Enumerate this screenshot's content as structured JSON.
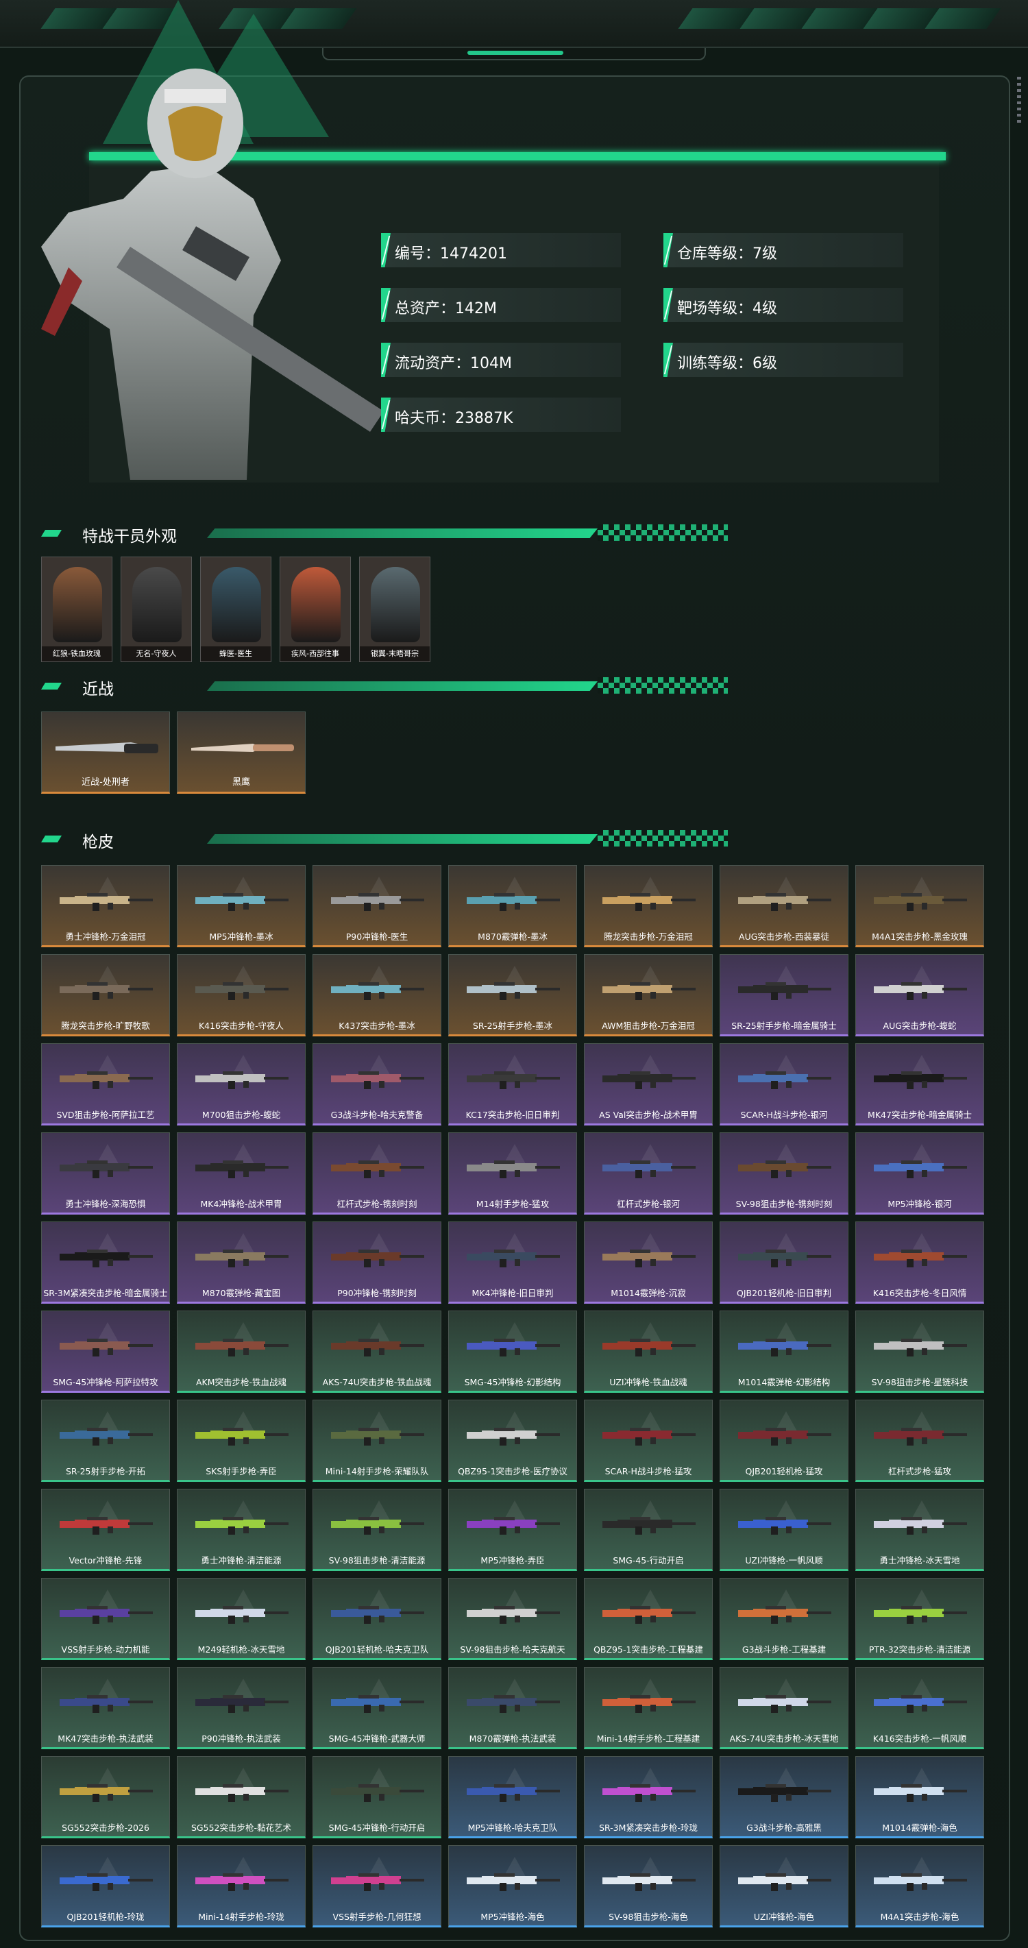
{
  "stats": [
    {
      "label": "编号：1474201"
    },
    {
      "label": "仓库等级：7级"
    },
    {
      "label": "总资产：142M"
    },
    {
      "label": "靶场等级：4级"
    },
    {
      "label": "流动资产：104M"
    },
    {
      "label": "训练等级：6级"
    },
    {
      "label": "哈夫币：23887K"
    }
  ],
  "sections": {
    "operators": "特战干员外观",
    "melee": "近战",
    "skins": "枪皮"
  },
  "operators": [
    {
      "name": "红狼-铁血玫瑰",
      "color": "#8a5a3a"
    },
    {
      "name": "无名-守夜人",
      "color": "#4a4a4a"
    },
    {
      "name": "蜂医-医生",
      "color": "#3a5a6a"
    },
    {
      "name": "疾风-西部往事",
      "color": "#c05a3a"
    },
    {
      "name": "银翼-末晤哥宗",
      "color": "#5a6a70"
    }
  ],
  "melee": [
    {
      "name": "近战-处刑者"
    },
    {
      "name": "黑鹰"
    }
  ],
  "skins": [
    {
      "name": "勇士冲锋枪-万金泪冠",
      "rarity": "orange",
      "gun": "#c9b48a"
    },
    {
      "name": "MP5冲锋枪-墨冰",
      "rarity": "orange",
      "gun": "#6fb0c0"
    },
    {
      "name": "P90冲锋枪-医生",
      "rarity": "orange",
      "gun": "#9a9a9a"
    },
    {
      "name": "M870霰弹枪-墨冰",
      "rarity": "orange",
      "gun": "#5aa0b0"
    },
    {
      "name": "腾龙突击步枪-万金泪冠",
      "rarity": "orange",
      "gun": "#c9a060"
    },
    {
      "name": "AUG突击步枪-西装暴徒",
      "rarity": "orange",
      "gun": "#b0a080"
    },
    {
      "name": "M4A1突击步枪-黑金玫瑰",
      "rarity": "orange",
      "gun": "#6a5a3a"
    },
    {
      "name": "腾龙突击步枪-旷野牧歌",
      "rarity": "orange",
      "gun": "#7a6a5a"
    },
    {
      "name": "K416突击步枪-守夜人",
      "rarity": "orange",
      "gun": "#5a5a50"
    },
    {
      "name": "K437突击步枪-墨冰",
      "rarity": "orange",
      "gun": "#70b0c0"
    },
    {
      "name": "SR-25射手步枪-墨冰",
      "rarity": "orange",
      "gun": "#b0c0c8"
    },
    {
      "name": "AWM狙击步枪-万金泪冠",
      "rarity": "orange",
      "gun": "#c0a070"
    },
    {
      "name": "SR-25射手步枪-暗金属骑士",
      "rarity": "purple",
      "gun": "#2a2a2a"
    },
    {
      "name": "AUG突击步枪-蝮蛇",
      "rarity": "purple",
      "gun": "#d0d0d0"
    },
    {
      "name": "SVD狙击步枪-阿萨拉工艺",
      "rarity": "purple",
      "gun": "#8a6a50"
    },
    {
      "name": "M700狙击步枪-蝮蛇",
      "rarity": "purple",
      "gun": "#c0c0c0"
    },
    {
      "name": "G3战斗步枪-哈夫克警备",
      "rarity": "purple",
      "gun": "#a05a6a"
    },
    {
      "name": "KC17突击步枪-旧日审判",
      "rarity": "purple",
      "gun": "#3a3a3a"
    },
    {
      "name": "AS Val突击步枪-战术甲胄",
      "rarity": "purple",
      "gun": "#2a2a2a"
    },
    {
      "name": "SCAR-H战斗步枪-银河",
      "rarity": "purple",
      "gun": "#4a70b0"
    },
    {
      "name": "MK47突击步枪-暗金属骑士",
      "rarity": "purple",
      "gun": "#1a1a1a"
    },
    {
      "name": "勇士冲锋枪-深海恐惧",
      "rarity": "purple",
      "gun": "#3a3a40"
    },
    {
      "name": "MK4冲锋枪-战术甲胄",
      "rarity": "purple",
      "gun": "#2a2a2a"
    },
    {
      "name": "杠杆式步枪-镌刻时刻",
      "rarity": "purple",
      "gun": "#7a4a30"
    },
    {
      "name": "M14射手步枪-猛攻",
      "rarity": "purple",
      "gun": "#8a8a8a"
    },
    {
      "name": "杠杆式步枪-银河",
      "rarity": "purple",
      "gun": "#4a60a0"
    },
    {
      "name": "SV-98狙击步枪-镌刻时刻",
      "rarity": "purple",
      "gun": "#6a4a30"
    },
    {
      "name": "MP5冲锋枪-银河",
      "rarity": "purple",
      "gun": "#4a70c0"
    },
    {
      "name": "SR-3M紧凑突击步枪-暗金属骑士",
      "rarity": "purple",
      "gun": "#1a1a1a"
    },
    {
      "name": "M870霰弹枪-藏宝图",
      "rarity": "purple",
      "gun": "#8a7a60"
    },
    {
      "name": "P90冲锋枪-镌刻时刻",
      "rarity": "purple",
      "gun": "#6a3a2a"
    },
    {
      "name": "MK4冲锋枪-旧日审判",
      "rarity": "purple",
      "gun": "#3a4a60"
    },
    {
      "name": "M1014霰弹枪-沉寂",
      "rarity": "purple",
      "gun": "#9a7a5a"
    },
    {
      "name": "QJB201轻机枪-旧日审判",
      "rarity": "purple",
      "gun": "#3a4a50"
    },
    {
      "name": "K416突击步枪-冬日风情",
      "rarity": "purple",
      "gun": "#a04a30"
    },
    {
      "name": "SMG-45冲锋枪-阿萨拉特攻",
      "rarity": "purple",
      "gun": "#8a5a50"
    },
    {
      "name": "AKM突击步枪-铁血战魂",
      "rarity": "green",
      "gun": "#8a4a3a"
    },
    {
      "name": "AKS-74U突击步枪-铁血战魂",
      "rarity": "green",
      "gun": "#6a3a2a"
    },
    {
      "name": "SMG-45冲锋枪-幻影结构",
      "rarity": "green",
      "gun": "#4a5ac0"
    },
    {
      "name": "UZI冲锋枪-铁血战魂",
      "rarity": "green",
      "gun": "#9a3a2a"
    },
    {
      "name": "M1014霰弹枪-幻影结构",
      "rarity": "green",
      "gun": "#4a6ac0"
    },
    {
      "name": "SV-98狙击步枪-星链科技",
      "rarity": "green",
      "gun": "#c0c0c0"
    },
    {
      "name": "SR-25射手步枪-开拓",
      "rarity": "green",
      "gun": "#3a6a9a"
    },
    {
      "name": "SKS射手步枪-弄臣",
      "rarity": "green",
      "gun": "#a0c030"
    },
    {
      "name": "Mini-14射手步枪-荣耀队队",
      "rarity": "green",
      "gun": "#5a6a40"
    },
    {
      "name": "QBZ95-1突击步枪-医疗协议",
      "rarity": "green",
      "gun": "#d0d0d0"
    },
    {
      "name": "SCAR-H战斗步枪-猛攻",
      "rarity": "green",
      "gun": "#8a2a30"
    },
    {
      "name": "QJB201轻机枪-猛攻",
      "rarity": "green",
      "gun": "#7a2a30"
    },
    {
      "name": "杠杆式步枪-猛攻",
      "rarity": "green",
      "gun": "#7a2a30"
    },
    {
      "name": "Vector冲锋枪-先锋",
      "rarity": "green",
      "gun": "#c03a3a"
    },
    {
      "name": "勇士冲锋枪-清洁能源",
      "rarity": "green",
      "gun": "#9ad040"
    },
    {
      "name": "SV-98狙击步枪-清洁能源",
      "rarity": "green",
      "gun": "#8ac040"
    },
    {
      "name": "MP5冲锋枪-弄臣",
      "rarity": "green",
      "gun": "#8a40c0"
    },
    {
      "name": "SMG-45-行动开启",
      "rarity": "green",
      "gun": "#2a2a2a"
    },
    {
      "name": "UZI冲锋枪-一帆风顺",
      "rarity": "green",
      "gun": "#3a60d0"
    },
    {
      "name": "勇士冲锋枪-冰天雪地",
      "rarity": "green",
      "gun": "#d0d0e0"
    },
    {
      "name": "VSS射手步枪-动力机能",
      "rarity": "green",
      "gun": "#5a40a0"
    },
    {
      "name": "M249轻机枪-冰天雪地",
      "rarity": "green",
      "gun": "#d0d8e8"
    },
    {
      "name": "QJB201轻机枪-哈夫克卫队",
      "rarity": "green",
      "gun": "#3a5a9a"
    },
    {
      "name": "SV-98狙击步枪-哈夫克航天",
      "rarity": "green",
      "gun": "#d0d0d0"
    },
    {
      "name": "QBZ95-1突击步枪-工程基建",
      "rarity": "green",
      "gun": "#d0603a"
    },
    {
      "name": "G3战斗步枪-工程基建",
      "rarity": "green",
      "gun": "#d0703a"
    },
    {
      "name": "PTR-32突击步枪-清洁能源",
      "rarity": "green",
      "gun": "#9ad040"
    },
    {
      "name": "MK47突击步枪-执法武装",
      "rarity": "green",
      "gun": "#3a4a8a"
    },
    {
      "name": "P90冲锋枪-执法武装",
      "rarity": "green",
      "gun": "#2a2a3a"
    },
    {
      "name": "SMG-45冲锋枪-武器大师",
      "rarity": "green",
      "gun": "#3a6ab0"
    },
    {
      "name": "M870霰弹枪-执法武装",
      "rarity": "green",
      "gun": "#3a4a6a"
    },
    {
      "name": "Mini-14射手步枪-工程基建",
      "rarity": "green",
      "gun": "#d0603a"
    },
    {
      "name": "AKS-74U突击步枪-冰天雪地",
      "rarity": "green",
      "gun": "#d0d8e8"
    },
    {
      "name": "K416突击步枪-一帆风顺",
      "rarity": "green",
      "gun": "#4a70d0"
    },
    {
      "name": "SG552突击步枪-2026",
      "rarity": "green",
      "gun": "#c0a040"
    },
    {
      "name": "SG552突击步枪-黏花艺术",
      "rarity": "green",
      "gun": "#e0e0e0"
    },
    {
      "name": "SMG-45冲锋枪-行动开启",
      "rarity": "green",
      "gun": "#3a4a3a"
    },
    {
      "name": "MP5冲锋枪-哈夫克卫队",
      "rarity": "blue",
      "gun": "#3a5ab0"
    },
    {
      "name": "SR-3M紧凑突击步枪-玲珑",
      "rarity": "blue",
      "gun": "#c050d0"
    },
    {
      "name": "G3战斗步枪-高雅黑",
      "rarity": "blue",
      "gun": "#1a1a1a"
    },
    {
      "name": "M1014霰弹枪-海色",
      "rarity": "blue",
      "gun": "#d0e0f0"
    },
    {
      "name": "QJB201轻机枪-玲珑",
      "rarity": "blue",
      "gun": "#3a6ad0"
    },
    {
      "name": "Mini-14射手步枪-玲珑",
      "rarity": "blue",
      "gun": "#d050c0"
    },
    {
      "name": "VSS射手步枪-几何狂想",
      "rarity": "blue",
      "gun": "#d04090"
    },
    {
      "name": "MP5冲锋枪-海色",
      "rarity": "blue",
      "gun": "#e0e8f0"
    },
    {
      "name": "SV-98狙击步枪-海色",
      "rarity": "blue",
      "gun": "#e0e8f0"
    },
    {
      "name": "UZI冲锋枪-海色",
      "rarity": "blue",
      "gun": "#e0e8f0"
    },
    {
      "name": "M4A1突击步枪-海色",
      "rarity": "blue",
      "gun": "#d0e0f0"
    }
  ]
}
